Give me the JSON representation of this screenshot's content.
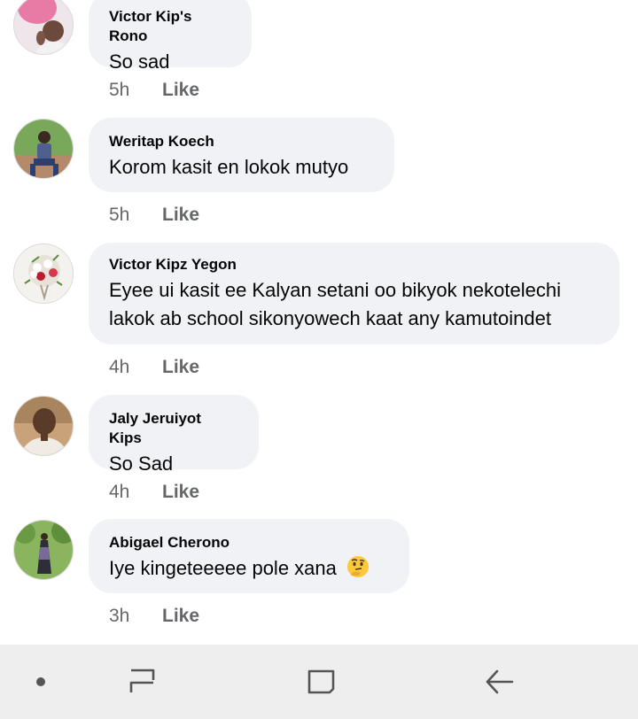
{
  "comments": [
    {
      "author": "Victor Kip's Rono",
      "text": "So sad",
      "time": "5h",
      "like_label": "Like",
      "avatar": "pink-profile-photo"
    },
    {
      "author": "Weritap Koech",
      "text": "Korom kasit en lokok mutyo",
      "time": "5h",
      "like_label": "Like",
      "avatar": "man-sitting-photo"
    },
    {
      "author": "Victor Kipz Yegon",
      "text": "Eyee ui kasit ee Kalyan setani oo bikyok nekotelechi lakok ab school sikonyowech kaat any kamutoindet",
      "text_line1": "Eyee ui kasit ee Kalyan setani oo bikyok nekotelechi",
      "text_line2": "lakok ab school sikonyowech kaat any kamutoindet",
      "time": "4h",
      "like_label": "Like",
      "avatar": "flower-bouquet-photo"
    },
    {
      "author": "Jaly Jeruiyot Kips",
      "text": "So Sad",
      "time": "4h",
      "like_label": "Like",
      "avatar": "man-portrait-photo"
    },
    {
      "author": "Abigael Cherono",
      "text": "Iye kingeteeeee pole xana",
      "emoji": "thinking-face",
      "time": "3h",
      "like_label": "Like",
      "avatar": "woman-standing-photo"
    }
  ],
  "navbar": {
    "buttons": [
      "dot-indicator",
      "recent-apps",
      "home",
      "back"
    ],
    "background": "#eeeeee"
  },
  "colors": {
    "bubble": "#f0f2f5",
    "meta": "#65676b",
    "text": "#050505"
  }
}
